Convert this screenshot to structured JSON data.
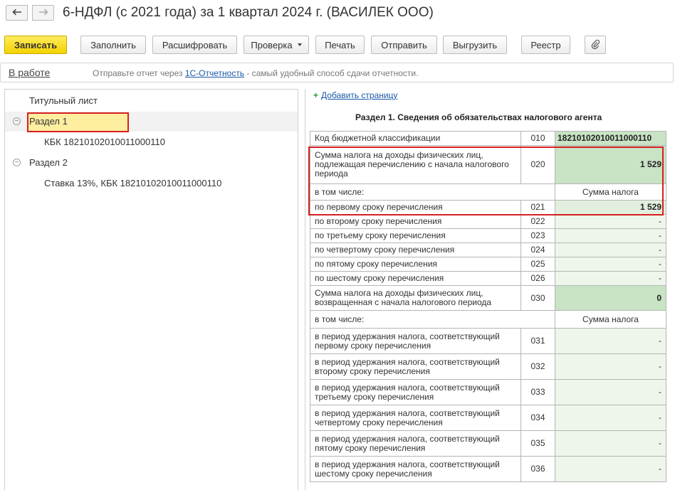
{
  "window": {
    "title": "6-НДФЛ (с 2021 года) за 1 квартал 2024 г. (ВАСИЛЕК ООО)",
    "back_glyph": "🡐",
    "forward_glyph": "→"
  },
  "toolbar": {
    "save": "Записать",
    "fill": "Заполнить",
    "decode": "Расшифровать",
    "check": "Проверка",
    "print": "Печать",
    "send": "Отправить",
    "export": "Выгрузить",
    "registry": "Реестр",
    "attach_icon": "paperclip-icon"
  },
  "status": {
    "state": "В работе",
    "msg_before": "Отправьте отчет через ",
    "msg_link": "1С-Отчетность",
    "msg_after": " - самый удобный способ сдачи отчетности."
  },
  "tree": {
    "items": [
      {
        "label": "Титульный лист"
      },
      {
        "label": "Раздел 1"
      },
      {
        "label": "КБК 18210102010011000110"
      },
      {
        "label": "Раздел 2"
      },
      {
        "label": "Ставка 13%, КБК 18210102010011000110"
      }
    ]
  },
  "form": {
    "add_page": "Добавить страницу",
    "section_title": "Раздел 1. Сведения об обязательствах налогового агента",
    "sum_header": "Сумма налога",
    "including": "в том числе:",
    "rows": {
      "kbk": {
        "label": "Код бюджетной классификации",
        "code": "010",
        "value": "18210102010011000110"
      },
      "r020": {
        "label": "Сумма налога на доходы физических лиц, подлежащая перечислению с начала налогового периода",
        "code": "020",
        "value": "1 529"
      },
      "r021": {
        "label": "по первому сроку перечисления",
        "code": "021",
        "value": "1 529"
      },
      "r022": {
        "label": "по второму сроку перечисления",
        "code": "022",
        "value": "-"
      },
      "r023": {
        "label": "по третьему сроку перечисления",
        "code": "023",
        "value": "-"
      },
      "r024": {
        "label": "по четвертому сроку перечисления",
        "code": "024",
        "value": "-"
      },
      "r025": {
        "label": "по пятому сроку перечисления",
        "code": "025",
        "value": "-"
      },
      "r026": {
        "label": "по шестому сроку перечисления",
        "code": "026",
        "value": "-"
      },
      "r030": {
        "label": "Сумма налога на доходы физических лиц, возвращенная с начала налогового периода",
        "code": "030",
        "value": "0"
      },
      "r031": {
        "label": "в период удержания налога, соответствующий первому сроку перечисления",
        "code": "031",
        "value": "-"
      },
      "r032": {
        "label": "в период удержания налога, соответствующий второму сроку перечисления",
        "code": "032",
        "value": "-"
      },
      "r033": {
        "label": "в период удержания налога, соответствующий третьему сроку перечисления",
        "code": "033",
        "value": "-"
      },
      "r034": {
        "label": "в период удержания налога, соответствующий четвертому сроку перечисления",
        "code": "034",
        "value": "-"
      },
      "r035": {
        "label": "в период удержания налога, соответствующий пятому сроку перечисления",
        "code": "035",
        "value": "-"
      },
      "r036": {
        "label": "в период удержания налога, соответствующий шестому сроку перечисления",
        "code": "036",
        "value": "-"
      }
    }
  }
}
